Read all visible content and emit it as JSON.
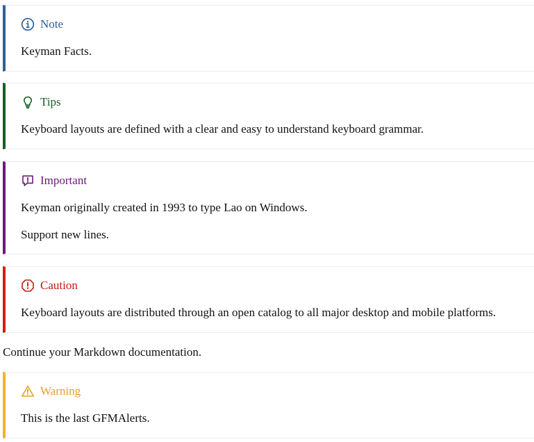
{
  "alerts": {
    "note": {
      "title": "Note",
      "icon": "info-icon",
      "color": "#2f6094",
      "paragraphs": [
        "Keyman Facts."
      ]
    },
    "tip": {
      "title": "Tips",
      "icon": "lightbulb-icon",
      "color": "#1a5d23",
      "paragraphs": [
        "Keyboard layouts are defined with a clear and easy to understand keyboard grammar."
      ]
    },
    "important": {
      "title": "Important",
      "icon": "comment-exclamation-icon",
      "color": "#6a1b79",
      "paragraphs": [
        "Keyman originally created in 1993 to type Lao on Windows.",
        "Support new lines."
      ]
    },
    "caution": {
      "title": "Caution",
      "icon": "octagon-exclamation-icon",
      "color": "#d21c13",
      "paragraphs": [
        "Keyboard layouts are distributed through an open catalog to all major desktop and mobile platforms."
      ]
    },
    "warning": {
      "title": "Warning",
      "icon": "triangle-warning-icon",
      "color": "#f0b429",
      "paragraphs": [
        "This is the last GFMAlerts."
      ]
    }
  },
  "body_text": "Continue your Markdown documentation."
}
